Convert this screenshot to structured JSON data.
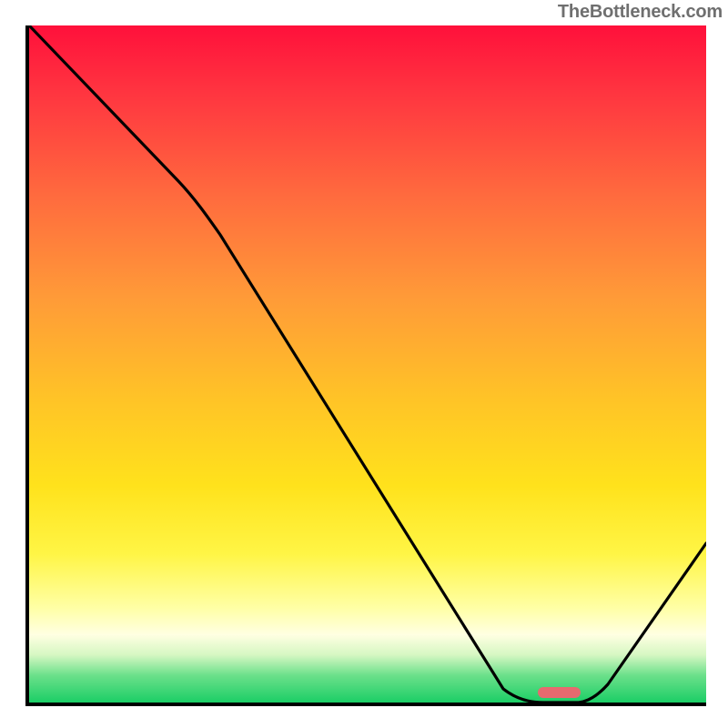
{
  "watermark": "TheBottleneck.com",
  "chart_data": {
    "type": "line",
    "title": "",
    "xlabel": "",
    "ylabel": "",
    "xlim": [
      0,
      1
    ],
    "ylim": [
      0,
      1
    ],
    "series": [
      {
        "name": "bottleneck-curve",
        "points": [
          {
            "x": 0.0,
            "y": 1.0
          },
          {
            "x": 0.22,
            "y": 0.77
          },
          {
            "x": 0.7,
            "y": 0.02
          },
          {
            "x": 0.76,
            "y": 0.0
          },
          {
            "x": 0.812,
            "y": 0.0
          },
          {
            "x": 1.0,
            "y": 0.235
          }
        ]
      }
    ],
    "marker": {
      "shape": "rounded-rect",
      "x0": 0.752,
      "x1": 0.815,
      "y": 0.008,
      "color": "#e76a6f"
    },
    "gradient_stops": [
      {
        "pos": 0.0,
        "color": "#ff103b"
      },
      {
        "pos": 0.55,
        "color": "#ffc327"
      },
      {
        "pos": 0.86,
        "color": "#ffffa5"
      },
      {
        "pos": 1.0,
        "color": "#1bce66"
      }
    ]
  }
}
